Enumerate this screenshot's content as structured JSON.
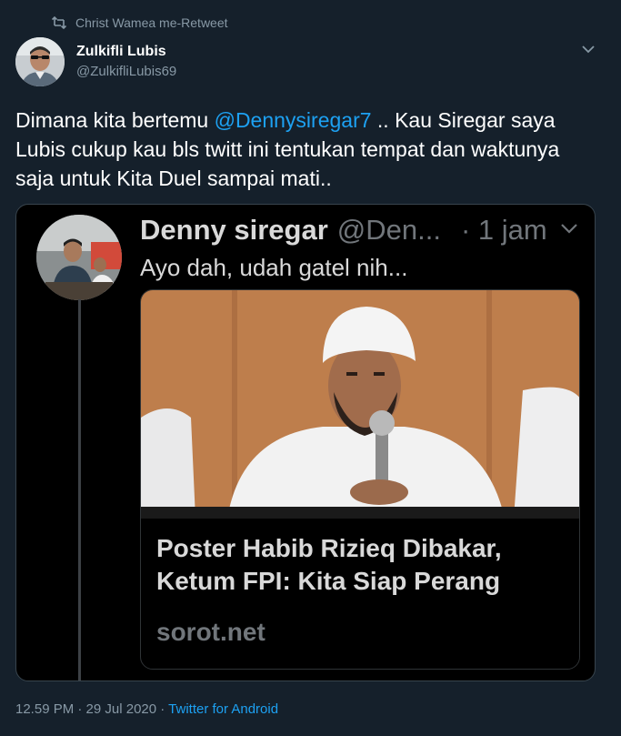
{
  "retweet": {
    "icon": "retweet-icon",
    "label": "Christ Wamea me-Retweet"
  },
  "author": {
    "name": "Zulkifli Lubis",
    "handle": "@ZulkifliLubis69"
  },
  "tweet": {
    "text_before": "Dimana kita bertemu ",
    "mention": "@Dennysiregar7",
    "text_after": " .. Kau Siregar saya Lubis cukup kau bls twitt ini tentukan tempat dan waktunya saja untuk Kita Duel sampai mati.."
  },
  "embedded_tweet": {
    "name": "Denny siregar",
    "handle": "@Den...",
    "time": "· 1 jam",
    "text": "Ayo dah, udah gatel nih...",
    "card": {
      "title": "Poster Habib Rizieq Dibakar, Ketum FPI: Kita Siap Perang",
      "domain": "sorot.net"
    }
  },
  "meta": {
    "timestamp": "12.59 PM · 29 Jul 2020 · ",
    "source": "Twitter for Android"
  },
  "colors": {
    "background": "#15202b",
    "link": "#1da1f2",
    "muted": "#8899a6"
  }
}
